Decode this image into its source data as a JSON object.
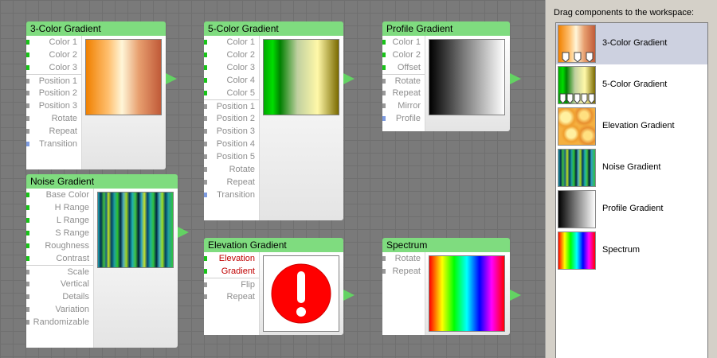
{
  "palette": {
    "hint": "Drag components to the workspace:",
    "items": [
      {
        "label": "3-Color Gradient",
        "selected": true
      },
      {
        "label": "5-Color Gradient",
        "selected": false
      },
      {
        "label": "Elevation Gradient",
        "selected": false
      },
      {
        "label": "Noise Gradient",
        "selected": false
      },
      {
        "label": "Profile Gradient",
        "selected": false
      },
      {
        "label": "Spectrum",
        "selected": false
      }
    ]
  },
  "nodes": {
    "three_color": {
      "title": "3-Color Gradient",
      "ports": [
        {
          "label": "Color 1",
          "pin": "green"
        },
        {
          "label": "Color 2",
          "pin": "green"
        },
        {
          "label": "Color 3",
          "pin": "green"
        },
        {
          "label": "Position 1",
          "pin": "gray"
        },
        {
          "label": "Position 2",
          "pin": "gray"
        },
        {
          "label": "Position 3",
          "pin": "gray"
        },
        {
          "label": "Rotate",
          "pin": "gray"
        },
        {
          "label": "Repeat",
          "pin": "gray"
        },
        {
          "label": "Transition",
          "pin": "blue"
        }
      ]
    },
    "five_color": {
      "title": "5-Color Gradient",
      "ports": [
        {
          "label": "Color 1",
          "pin": "green"
        },
        {
          "label": "Color 2",
          "pin": "green"
        },
        {
          "label": "Color 3",
          "pin": "green"
        },
        {
          "label": "Color 4",
          "pin": "green"
        },
        {
          "label": "Color 5",
          "pin": "green"
        },
        {
          "label": "Position 1",
          "pin": "gray"
        },
        {
          "label": "Position 2",
          "pin": "gray"
        },
        {
          "label": "Position 3",
          "pin": "gray"
        },
        {
          "label": "Position 4",
          "pin": "gray"
        },
        {
          "label": "Position 5",
          "pin": "gray"
        },
        {
          "label": "Rotate",
          "pin": "gray"
        },
        {
          "label": "Repeat",
          "pin": "gray"
        },
        {
          "label": "Transition",
          "pin": "blue"
        }
      ]
    },
    "profile": {
      "title": "Profile Gradient",
      "ports": [
        {
          "label": "Color 1",
          "pin": "green"
        },
        {
          "label": "Color 2",
          "pin": "green"
        },
        {
          "label": "Offset",
          "pin": "green"
        },
        {
          "label": "Rotate",
          "pin": "gray"
        },
        {
          "label": "Repeat",
          "pin": "gray"
        },
        {
          "label": "Mirror",
          "pin": "gray"
        },
        {
          "label": "Profile",
          "pin": "blue"
        }
      ]
    },
    "noise": {
      "title": "Noise Gradient",
      "ports": [
        {
          "label": "Base Color",
          "pin": "green"
        },
        {
          "label": "H Range",
          "pin": "green"
        },
        {
          "label": "L Range",
          "pin": "green"
        },
        {
          "label": "S Range",
          "pin": "green"
        },
        {
          "label": "Roughness",
          "pin": "green"
        },
        {
          "label": "Contrast",
          "pin": "green"
        },
        {
          "label": "Scale",
          "pin": "gray"
        },
        {
          "label": "Vertical",
          "pin": "gray"
        },
        {
          "label": "Details",
          "pin": "gray"
        },
        {
          "label": "Variation",
          "pin": "gray"
        },
        {
          "label": "Randomizable",
          "pin": "gray"
        }
      ]
    },
    "elevation": {
      "title": "Elevation Gradient",
      "ports": [
        {
          "label": "Elevation",
          "pin": "green",
          "error": true
        },
        {
          "label": "Gradient",
          "pin": "green",
          "error": true
        },
        {
          "label": "Flip",
          "pin": "gray"
        },
        {
          "label": "Repeat",
          "pin": "gray"
        }
      ]
    },
    "spectrum": {
      "title": "Spectrum",
      "ports": [
        {
          "label": "Rotate",
          "pin": "gray"
        },
        {
          "label": "Repeat",
          "pin": "gray"
        }
      ]
    }
  },
  "colors": {
    "title_bar": "#7fdc7f",
    "pin_color": "#18c418",
    "pin_number": "#999999",
    "pin_blue": "#7d9be0",
    "error_text": "#c00000",
    "error_icon": "#ff0000",
    "output_arrow": "#63d363",
    "selection": "#cdd1e0"
  }
}
